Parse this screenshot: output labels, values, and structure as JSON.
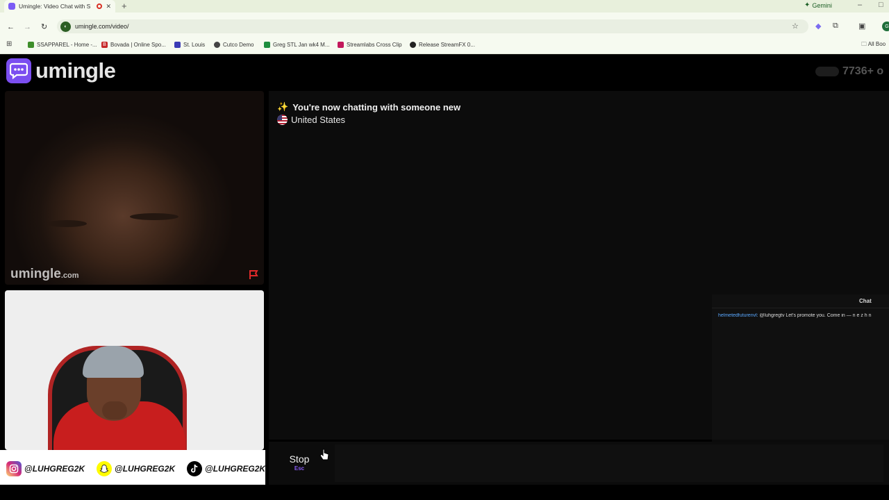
{
  "browser": {
    "tab_title": "Umingle: Video Chat with S",
    "url": "umingle.com/video/",
    "gemini_label": "Gemini",
    "bookmarks": [
      {
        "label": "SSAPPAREL - Home -...",
        "color": "#3e8e2a"
      },
      {
        "label": "Bovada | Online Spo...",
        "color": "#c62828"
      },
      {
        "label": "St. Louis",
        "color": "#3b3bb5"
      },
      {
        "label": "Cutco Demo",
        "color": "#444444"
      },
      {
        "label": "Greg STL Jan wk4 M...",
        "color": "#1e8e3e"
      },
      {
        "label": "Streamlabs Cross Clip",
        "color": "#c2185b"
      },
      {
        "label": "Release StreamFX 0...",
        "color": "#222222"
      }
    ],
    "all_bookmarks_label": "All Boo"
  },
  "site": {
    "logo_text": "umingle",
    "online_count": "7736+ o"
  },
  "remote_video": {
    "watermark": "umingle",
    "watermark_suffix": ".com"
  },
  "chat": {
    "system_message": "You're now chatting with someone new",
    "country": "United States",
    "input_value": ""
  },
  "overlay": {
    "title": "Chat",
    "messages": [
      {
        "user": "helmetedfuturenvl:",
        "text": " @luhgregtv Let's promote you. Come in — n e z h n"
      }
    ]
  },
  "controls": {
    "stop_label": "Stop",
    "stop_hint": "Esc"
  },
  "socials": [
    {
      "platform": "instagram-icon",
      "handle": "@LUHGREG2K",
      "color": "#d62976"
    },
    {
      "platform": "snapchat-icon",
      "handle": "@LUHGREG2K",
      "color": "#fffc00"
    },
    {
      "platform": "tiktok-icon",
      "handle": "@LUHGREG2K",
      "color": "#000000"
    }
  ]
}
